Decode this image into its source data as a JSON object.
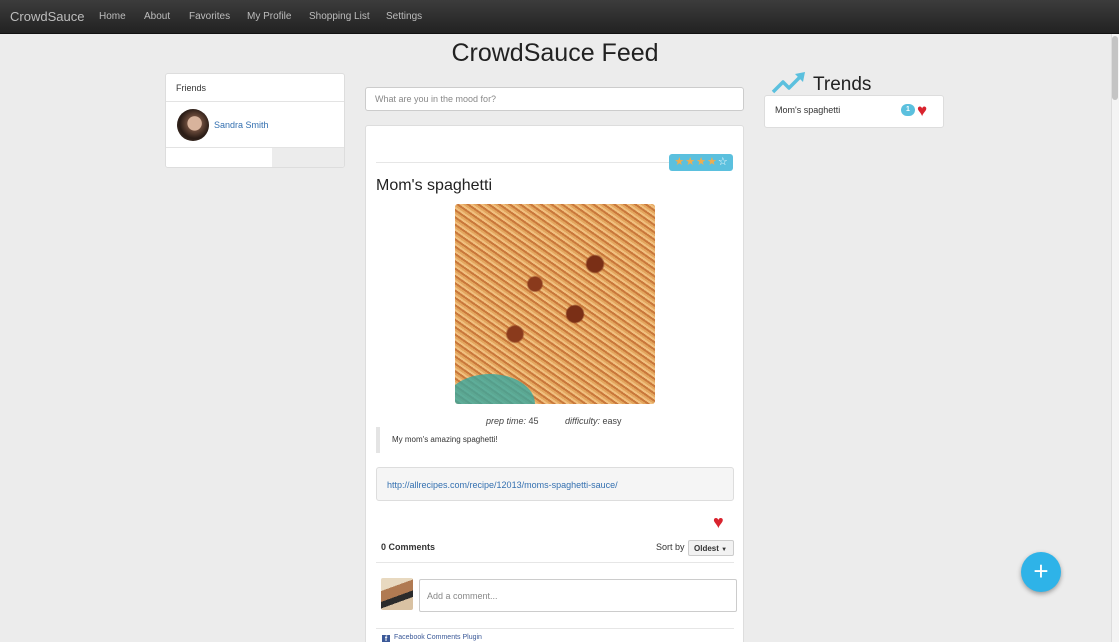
{
  "navbar": {
    "brand": "CrowdSauce",
    "items": [
      "Home",
      "About",
      "Favorites",
      "My Profile",
      "Shopping List",
      "Settings"
    ]
  },
  "page_title": "CrowdSauce Feed",
  "friends": {
    "heading": "Friends",
    "list": [
      {
        "name": "Sandra Smith"
      }
    ]
  },
  "search": {
    "placeholder": "What are you in the mood for?"
  },
  "recipe": {
    "title": "Mom's spaghetti",
    "rating": {
      "value": 4,
      "max": 5
    },
    "prep_time_label": "prep time:",
    "prep_time_value": "45",
    "difficulty_label": "difficulty:",
    "difficulty_value": "easy",
    "description": "My mom's amazing spaghetti!",
    "url": "http://allrecipes.com/recipe/12013/moms-spaghetti-sauce/"
  },
  "comments": {
    "count_label": "0 Comments",
    "sort_label": "Sort by",
    "sort_value": "Oldest",
    "placeholder": "Add a comment...",
    "plugin_label": "Facebook Comments Plugin"
  },
  "trends": {
    "title": "Trends",
    "items": [
      {
        "label": "Mom's spaghetti",
        "count": "1"
      }
    ]
  },
  "colors": {
    "navbar": "#2a2a2a",
    "link": "#3470b0",
    "accent": "#5bc0de",
    "heart": "#d9232e",
    "fab": "#2eb3e8",
    "star": "#f0ad4e"
  },
  "icons": {
    "trend": "trending-up-icon",
    "heart": "heart-icon",
    "fab": "plus-icon",
    "facebook": "facebook-icon"
  }
}
